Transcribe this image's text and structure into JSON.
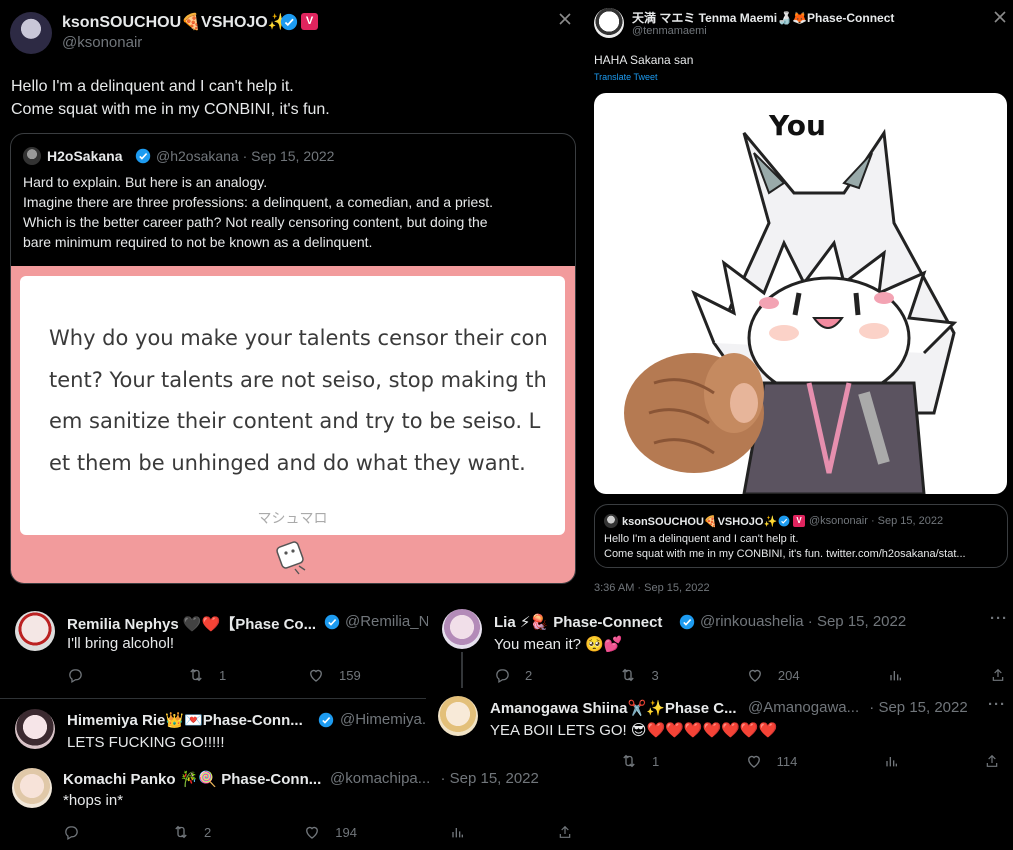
{
  "main_tweet": {
    "author": "ksonSOUCHOU🍕VSHOJO✨",
    "handle": "@ksononair",
    "badge": "V",
    "text_line1": "Hello I'm a delinquent and I can't help it.",
    "text_line2": "Come squat with me in my CONBINI, it's fun.",
    "quote": {
      "author": "H2oSakana",
      "handle": "@h2osakana",
      "date": "· Sep 15, 2022",
      "line1": "Hard to explain. But here is an analogy.",
      "line2": "Imagine there are three professions: a delinquent, a comedian, and a priest.",
      "line3": "Which is the better career path? Not really censoring content, but doing the",
      "line4": "bare minimum required to not be known as a delinquent.",
      "mm_line1": "Why do you make your talents censor their con",
      "mm_line2": "tent? Your talents are not seiso, stop making th",
      "mm_line3": "em sanitize their content and try to be seiso. L",
      "mm_line4": "et them be unhinged and do what they want.",
      "mm_footer": "マシュマロ"
    }
  },
  "right_tweet": {
    "author": "天満 マエミ Tenma Maemi🍶🦊Phase-Connect",
    "handle": "@tenmamaemi",
    "text": "HAHA Sakana san",
    "translate": "Translate Tweet",
    "image_caption": "You",
    "quote": {
      "author": "ksonSOUCHOU🍕VSHOJO✨",
      "badge": "V",
      "handle": "@ksononair",
      "date": "· Sep 15, 2022",
      "line1": "Hello I'm a delinquent and I can't help it.",
      "line2": "Come squat with me in my CONBINI, it's fun. twitter.com/h2osakana/stat..."
    },
    "timestamp": "3:36 AM · Sep 15, 2022"
  },
  "replies": {
    "remilia": {
      "author": "Remilia Nephys 🖤❤️【Phase Co...",
      "handle": "@Remilia_N...",
      "text": "I'll bring alcohol!",
      "retweets": "1",
      "likes": "159"
    },
    "lia": {
      "author": "Lia ⚡🪼 Phase-Connect",
      "handle": "@rinkouashelia",
      "date": "· Sep 15, 2022",
      "text": "You mean it? 🥺💕",
      "replies": "2",
      "retweets": "3",
      "likes": "204"
    },
    "himemiya": {
      "author": "Himemiya Rie👑💌Phase-Conn...",
      "handle": "@Himemiya..",
      "text": "LETS FUCKING GO!!!!!"
    },
    "amanogawa": {
      "author": "Amanogawa Shiina✂️✨Phase C...",
      "handle": "@Amanogawa...",
      "date": "· Sep 15, 2022",
      "text": "YEA BOII LETS GO! 😎❤️❤️❤️❤️❤️❤️❤️",
      "retweets": "1",
      "likes": "114"
    },
    "komachi": {
      "author": "Komachi Panko 🎋🍭 Phase-Conn...",
      "handle": "@komachipa...",
      "date": "· Sep 15, 2022",
      "text": "*hops in*",
      "retweets": "2",
      "likes": "194"
    }
  },
  "colors": {
    "verified": "#1d9bf0",
    "vshojo": "#e0245e",
    "marshmallow_bg": "#f29b9c",
    "link": "#1d9bf0"
  }
}
